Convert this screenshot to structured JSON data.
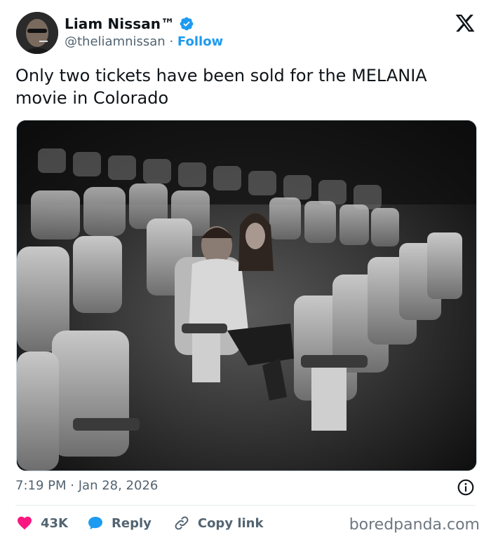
{
  "author": {
    "display_name": "Liam Nissan™",
    "handle": "@theliamnissan",
    "separator": "·",
    "follow_label": "Follow"
  },
  "tweet": {
    "text": "Only two tickets have been sold for the MELANIA movie in Colorado"
  },
  "meta": {
    "time": "7:19 PM",
    "separator": "·",
    "date": "Jan 28, 2026"
  },
  "actions": {
    "likes": "43K",
    "reply_label": "Reply",
    "copy_label": "Copy link"
  },
  "watermark": "boredpanda.com",
  "colors": {
    "accent": "#1d9bf0",
    "like": "#f91880",
    "text": "#0f1419",
    "muted": "#536471"
  },
  "icons": [
    "verified-badge-icon",
    "x-logo-icon",
    "info-icon",
    "heart-icon",
    "reply-bubble-icon",
    "link-icon"
  ]
}
